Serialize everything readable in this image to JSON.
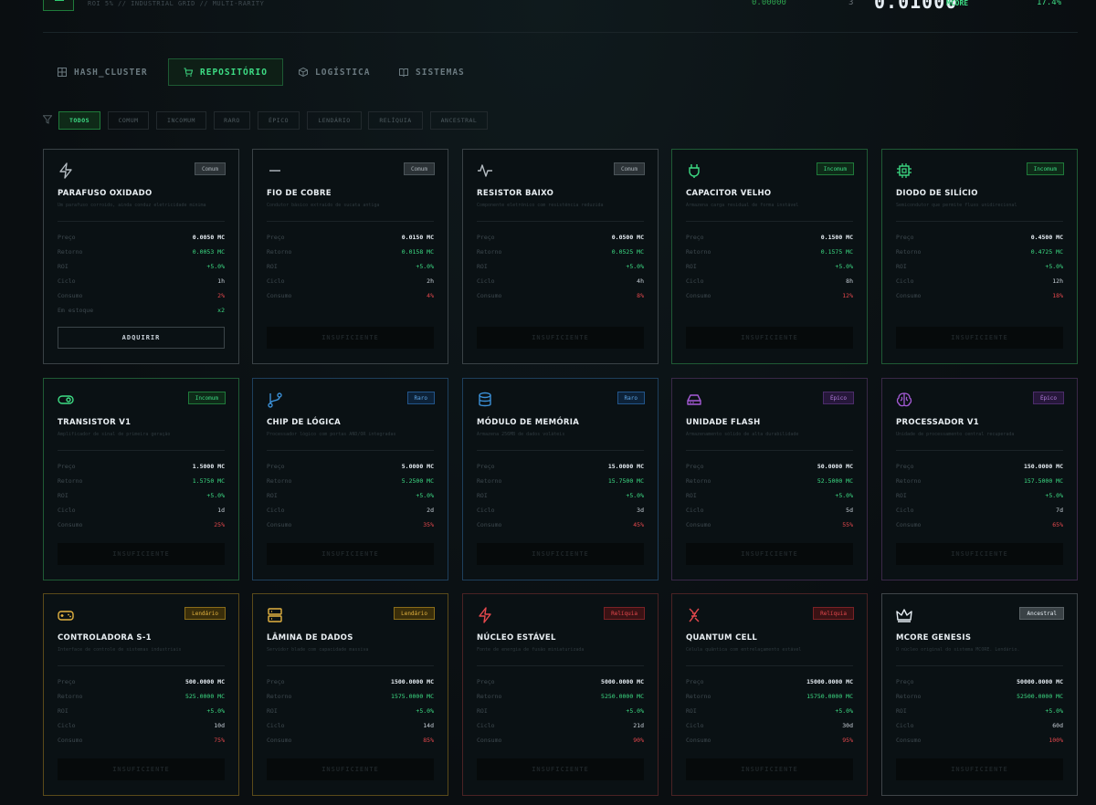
{
  "header": {
    "subtitle": "ROI 5% // INDUSTRIAL GRID // MULTI-RARITY",
    "stat_left": "0.00000",
    "stat_count": "3",
    "balance": "0.01000",
    "balance_unit": "MCORE",
    "pct": "17.4%"
  },
  "tabs": [
    {
      "label": "HASH_CLUSTER",
      "icon": "grid-icon"
    },
    {
      "label": "REPOSITÓRIO",
      "icon": "cart-icon"
    },
    {
      "label": "LOGÍSTICA",
      "icon": "box-icon"
    },
    {
      "label": "SISTEMAS",
      "icon": "book-icon"
    }
  ],
  "filters": [
    "TODOS",
    "COMUM",
    "INCOMUM",
    "RARO",
    "ÉPICO",
    "LENDÁRIO",
    "RELÍQUIA",
    "ANCESTRAL"
  ],
  "labels": {
    "price": "Preço",
    "return": "Retorno",
    "roi": "ROI",
    "cycle": "Ciclo",
    "consumption": "Consumo",
    "stock": "Em estoque",
    "buy": "ADQUIRIR",
    "insufficient": "INSUFICIENTE"
  },
  "colors": {
    "comum": "#8b949e",
    "incomum": "#3ddc84",
    "raro": "#3b82c4",
    "epico": "#a55bd6",
    "lendario": "#e3b341",
    "reliquia": "#e5484d",
    "ancestral": "#e6edf3"
  },
  "items": [
    {
      "name": "PARAFUSO OXIDADO",
      "desc": "Um parafuso corroído, ainda conduz eletricidade mínima",
      "rarity": "Comum",
      "r": "comum",
      "icon": "bolt-icon",
      "price": "0.0050 MC",
      "ret": "0.0053 MC",
      "roi": "+5.0%",
      "cycle": "1h",
      "cons": "2%",
      "stock": "x2",
      "action": "buy"
    },
    {
      "name": "FIO DE COBRE",
      "desc": "Condutor básico extraído de sucata antiga",
      "rarity": "Comum",
      "r": "comum",
      "icon": "minus-icon",
      "price": "0.0150 MC",
      "ret": "0.0158 MC",
      "roi": "+5.0%",
      "cycle": "2h",
      "cons": "4%",
      "action": "insuf"
    },
    {
      "name": "RESISTOR BAIXO",
      "desc": "Componente eletrônico com resistência reduzida",
      "rarity": "Comum",
      "r": "comum",
      "icon": "pulse-icon",
      "price": "0.0500 MC",
      "ret": "0.0525 MC",
      "roi": "+5.0%",
      "cycle": "4h",
      "cons": "8%",
      "action": "insuf"
    },
    {
      "name": "CAPACITOR VELHO",
      "desc": "Armazena carga residual de forma instável",
      "rarity": "Incomum",
      "r": "incomum",
      "icon": "plug-icon",
      "price": "0.1500 MC",
      "ret": "0.1575 MC",
      "roi": "+5.0%",
      "cycle": "8h",
      "cons": "12%",
      "action": "insuf"
    },
    {
      "name": "DIODO DE SILÍCIO",
      "desc": "Semicondutor que permite fluxo unidirecional",
      "rarity": "Incomum",
      "r": "incomum",
      "icon": "chip-icon",
      "price": "0.4500 MC",
      "ret": "0.4725 MC",
      "roi": "+5.0%",
      "cycle": "12h",
      "cons": "18%",
      "action": "insuf"
    },
    {
      "name": "TRANSISTOR V1",
      "desc": "Amplificador de sinal de primeira geração",
      "rarity": "Incomum",
      "r": "incomum",
      "icon": "toggle-icon",
      "price": "1.5000 MC",
      "ret": "1.5750 MC",
      "roi": "+5.0%",
      "cycle": "1d",
      "cons": "25%",
      "action": "insuf"
    },
    {
      "name": "CHIP DE LÓGICA",
      "desc": "Processador lógico com portas AND/OR integradas",
      "rarity": "Raro",
      "r": "raro",
      "icon": "branch-icon",
      "price": "5.0000 MC",
      "ret": "5.2500 MC",
      "roi": "+5.0%",
      "cycle": "2d",
      "cons": "35%",
      "action": "insuf"
    },
    {
      "name": "MÓDULO DE MEMÓRIA",
      "desc": "Armazena 256MB de dados voláteis",
      "rarity": "Raro",
      "r": "raro",
      "icon": "database-icon",
      "price": "15.0000 MC",
      "ret": "15.7500 MC",
      "roi": "+5.0%",
      "cycle": "3d",
      "cons": "45%",
      "action": "insuf"
    },
    {
      "name": "UNIDADE FLASH",
      "desc": "Armazenamento sólido de alta durabilidade",
      "rarity": "Épico",
      "r": "epico",
      "icon": "drive-icon",
      "price": "50.0000 MC",
      "ret": "52.5000 MC",
      "roi": "+5.0%",
      "cycle": "5d",
      "cons": "55%",
      "action": "insuf"
    },
    {
      "name": "PROCESSADOR V1",
      "desc": "Unidade de processamento central recuperada",
      "rarity": "Épico",
      "r": "epico",
      "icon": "brain-icon",
      "price": "150.0000 MC",
      "ret": "157.5000 MC",
      "roi": "+5.0%",
      "cycle": "7d",
      "cons": "65%",
      "action": "insuf"
    },
    {
      "name": "CONTROLADORA S-1",
      "desc": "Interface de controle de sistemas industriais",
      "rarity": "Lendário",
      "r": "lendario",
      "icon": "gamepad-icon",
      "price": "500.0000 MC",
      "ret": "525.0000 MC",
      "roi": "+5.0%",
      "cycle": "10d",
      "cons": "75%",
      "action": "insuf"
    },
    {
      "name": "LÂMINA DE DADOS",
      "desc": "Servidor blade com capacidade massiva",
      "rarity": "Lendário",
      "r": "lendario",
      "icon": "server-icon",
      "price": "1500.0000 MC",
      "ret": "1575.0000 MC",
      "roi": "+5.0%",
      "cycle": "14d",
      "cons": "85%",
      "action": "insuf"
    },
    {
      "name": "NÚCLEO ESTÁVEL",
      "desc": "Fonte de energia de fusão miniaturizada",
      "rarity": "Relíquia",
      "r": "reliquia",
      "icon": "zap-icon",
      "price": "5000.0000 MC",
      "ret": "5250.0000 MC",
      "roi": "+5.0%",
      "cycle": "21d",
      "cons": "90%",
      "action": "insuf"
    },
    {
      "name": "QUANTUM CELL",
      "desc": "Célula quântica com entrelaçamento estável",
      "rarity": "Relíquia",
      "r": "reliquia",
      "icon": "dna-icon",
      "price": "15000.0000 MC",
      "ret": "15750.0000 MC",
      "roi": "+5.0%",
      "cycle": "30d",
      "cons": "95%",
      "action": "insuf"
    },
    {
      "name": "MCORE GENESIS",
      "desc": "O núcleo original do sistema MCORE. Lendário.",
      "rarity": "Ancestral",
      "r": "ancestral",
      "icon": "crown-icon",
      "price": "50000.0000 MC",
      "ret": "52500.0000 MC",
      "roi": "+5.0%",
      "cycle": "60d",
      "cons": "100%",
      "action": "insuf"
    }
  ]
}
